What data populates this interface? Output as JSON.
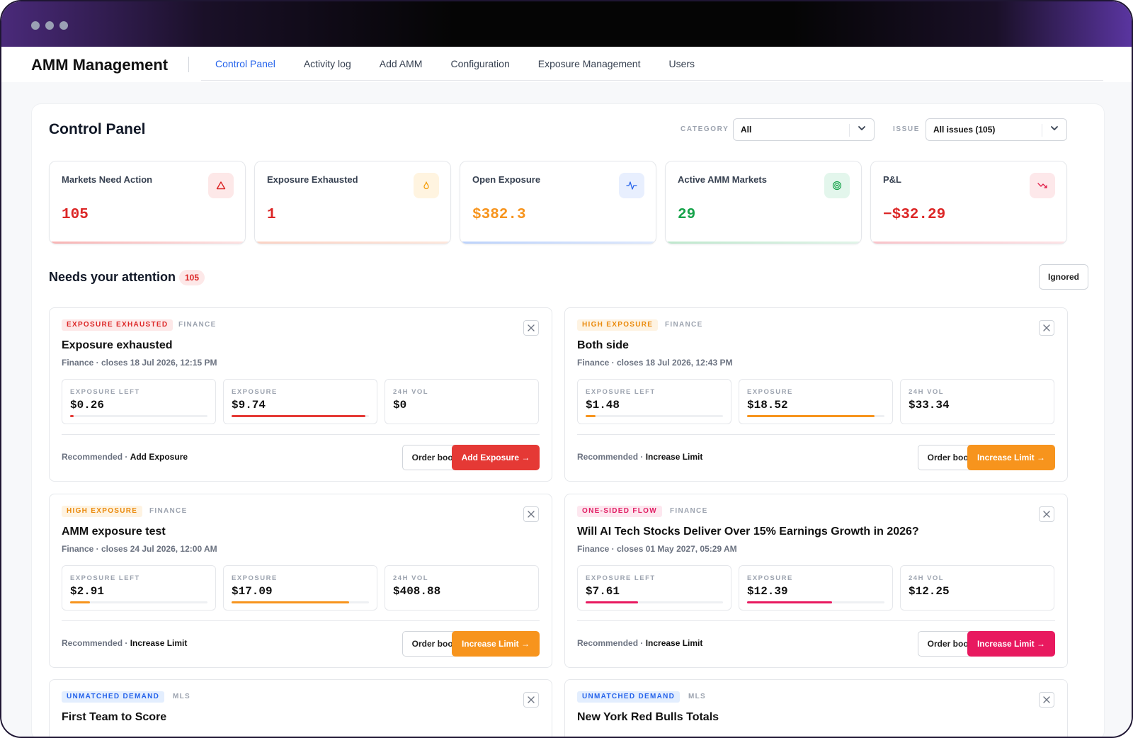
{
  "app": {
    "title": "AMM Management",
    "tabs": [
      "Control Panel",
      "Activity log",
      "Add AMM",
      "Configuration",
      "Exposure Management",
      "Users"
    ],
    "active_tab": "Control Panel"
  },
  "panel": {
    "title": "Control Panel",
    "category_label": "CATEGORY",
    "category_value": "All",
    "issue_label": "ISSUE",
    "issue_value": "All issues (105)"
  },
  "stats": [
    {
      "label": "Markets Need Action",
      "value": "105",
      "color": "#dc2626",
      "icon": "alert-triangle-icon"
    },
    {
      "label": "Exposure Exhausted",
      "value": "1",
      "color": "#dc2626",
      "icon": "flame-icon"
    },
    {
      "label": "Open Exposure",
      "value": "$382.3",
      "color": "#f7941d",
      "icon": "activity-icon"
    },
    {
      "label": "Active AMM Markets",
      "value": "29",
      "color": "#16a34a",
      "icon": "target-icon"
    },
    {
      "label": "P&L",
      "value": "−$32.29",
      "color": "#dc2626",
      "icon": "trending-down-icon"
    }
  ],
  "attention": {
    "title": "Needs your attention",
    "count": "105",
    "ignored_label": "Ignored"
  },
  "cards": [
    {
      "tag": "EXPOSURE EXHAUSTED",
      "tag_color": "red",
      "category": "FINANCE",
      "title": "Exposure exhausted",
      "subtitle": "Finance · closes 18 Jul 2026, 12:15 PM",
      "metrics": [
        {
          "label": "EXPOSURE LEFT",
          "value": "$0.26",
          "fill": 0.027,
          "color": "#e53935"
        },
        {
          "label": "EXPOSURE",
          "value": "$9.74",
          "fill": 0.974,
          "color": "#e53935"
        },
        {
          "label": "24H VOL",
          "value": "$0"
        }
      ],
      "rec_prefix": "Recommended · ",
      "rec_action": "Add Exposure",
      "order_label": "Order book",
      "action_label": "Add Exposure"
    },
    {
      "tag": "HIGH EXPOSURE",
      "tag_color": "orange",
      "category": "FINANCE",
      "title": "Both side",
      "subtitle": "Finance · closes 18 Jul 2026, 12:43 PM",
      "metrics": [
        {
          "label": "EXPOSURE LEFT",
          "value": "$1.48",
          "fill": 0.074,
          "color": "#f7941d"
        },
        {
          "label": "EXPOSURE",
          "value": "$18.52",
          "fill": 0.926,
          "color": "#f7941d"
        },
        {
          "label": "24H VOL",
          "value": "$33.34"
        }
      ],
      "rec_prefix": "Recommended · ",
      "rec_action": "Increase Limit",
      "order_label": "Order book",
      "action_label": "Increase Limit"
    },
    {
      "tag": "HIGH EXPOSURE",
      "tag_color": "orange",
      "category": "FINANCE",
      "title": "AMM exposure test",
      "subtitle": "Finance · closes 24 Jul 2026, 12:00 AM",
      "metrics": [
        {
          "label": "EXPOSURE LEFT",
          "value": "$2.91",
          "fill": 0.146,
          "color": "#f7941d"
        },
        {
          "label": "EXPOSURE",
          "value": "$17.09",
          "fill": 0.854,
          "color": "#f7941d"
        },
        {
          "label": "24H VOL",
          "value": "$408.88"
        }
      ],
      "rec_prefix": "Recommended · ",
      "rec_action": "Increase Limit",
      "order_label": "Order book",
      "action_label": "Increase Limit"
    },
    {
      "tag": "ONE-SIDED FLOW",
      "tag_color": "pink",
      "category": "FINANCE",
      "title": "Will AI Tech Stocks Deliver Over 15% Earnings Growth in 2026?",
      "subtitle": "Finance · closes 01 May 2027, 05:29 AM",
      "metrics": [
        {
          "label": "EXPOSURE LEFT",
          "value": "$7.61",
          "fill": 0.38,
          "color": "#e8195f"
        },
        {
          "label": "EXPOSURE",
          "value": "$12.39",
          "fill": 0.62,
          "color": "#e8195f"
        },
        {
          "label": "24H VOL",
          "value": "$12.25"
        }
      ],
      "rec_prefix": "Recommended · ",
      "rec_action": "Increase Limit",
      "order_label": "Order book",
      "action_label": "Increase Limit"
    },
    {
      "tag": "UNMATCHED DEMAND",
      "tag_color": "blue",
      "category": "MLS",
      "title": "First Team to Score"
    },
    {
      "tag": "UNMATCHED DEMAND",
      "tag_color": "blue",
      "category": "MLS",
      "title": "New York Red Bulls Totals"
    }
  ]
}
